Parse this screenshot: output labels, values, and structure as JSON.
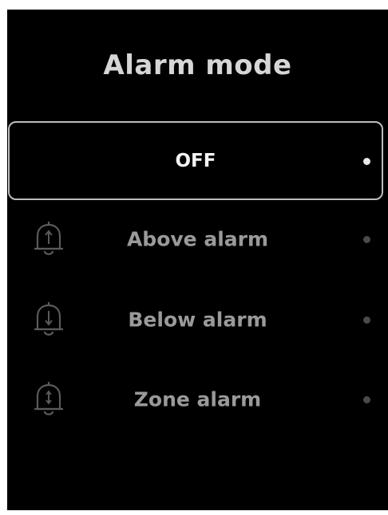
{
  "screen": {
    "title": "Alarm mode",
    "options": [
      {
        "label": "OFF",
        "selected": true,
        "icon": ""
      },
      {
        "label": "Above alarm",
        "selected": false,
        "icon": "bell-up-arrow-icon"
      },
      {
        "label": "Below alarm",
        "selected": false,
        "icon": "bell-down-arrow-icon"
      },
      {
        "label": "Zone alarm",
        "selected": false,
        "icon": "bell-double-arrow-icon"
      }
    ]
  },
  "colors": {
    "background": "#000000",
    "selected_border": "#bdbdbd",
    "selected_text": "#f4f4f4",
    "muted_text": "#9a9a9a",
    "icon": "#5a5a5a"
  }
}
